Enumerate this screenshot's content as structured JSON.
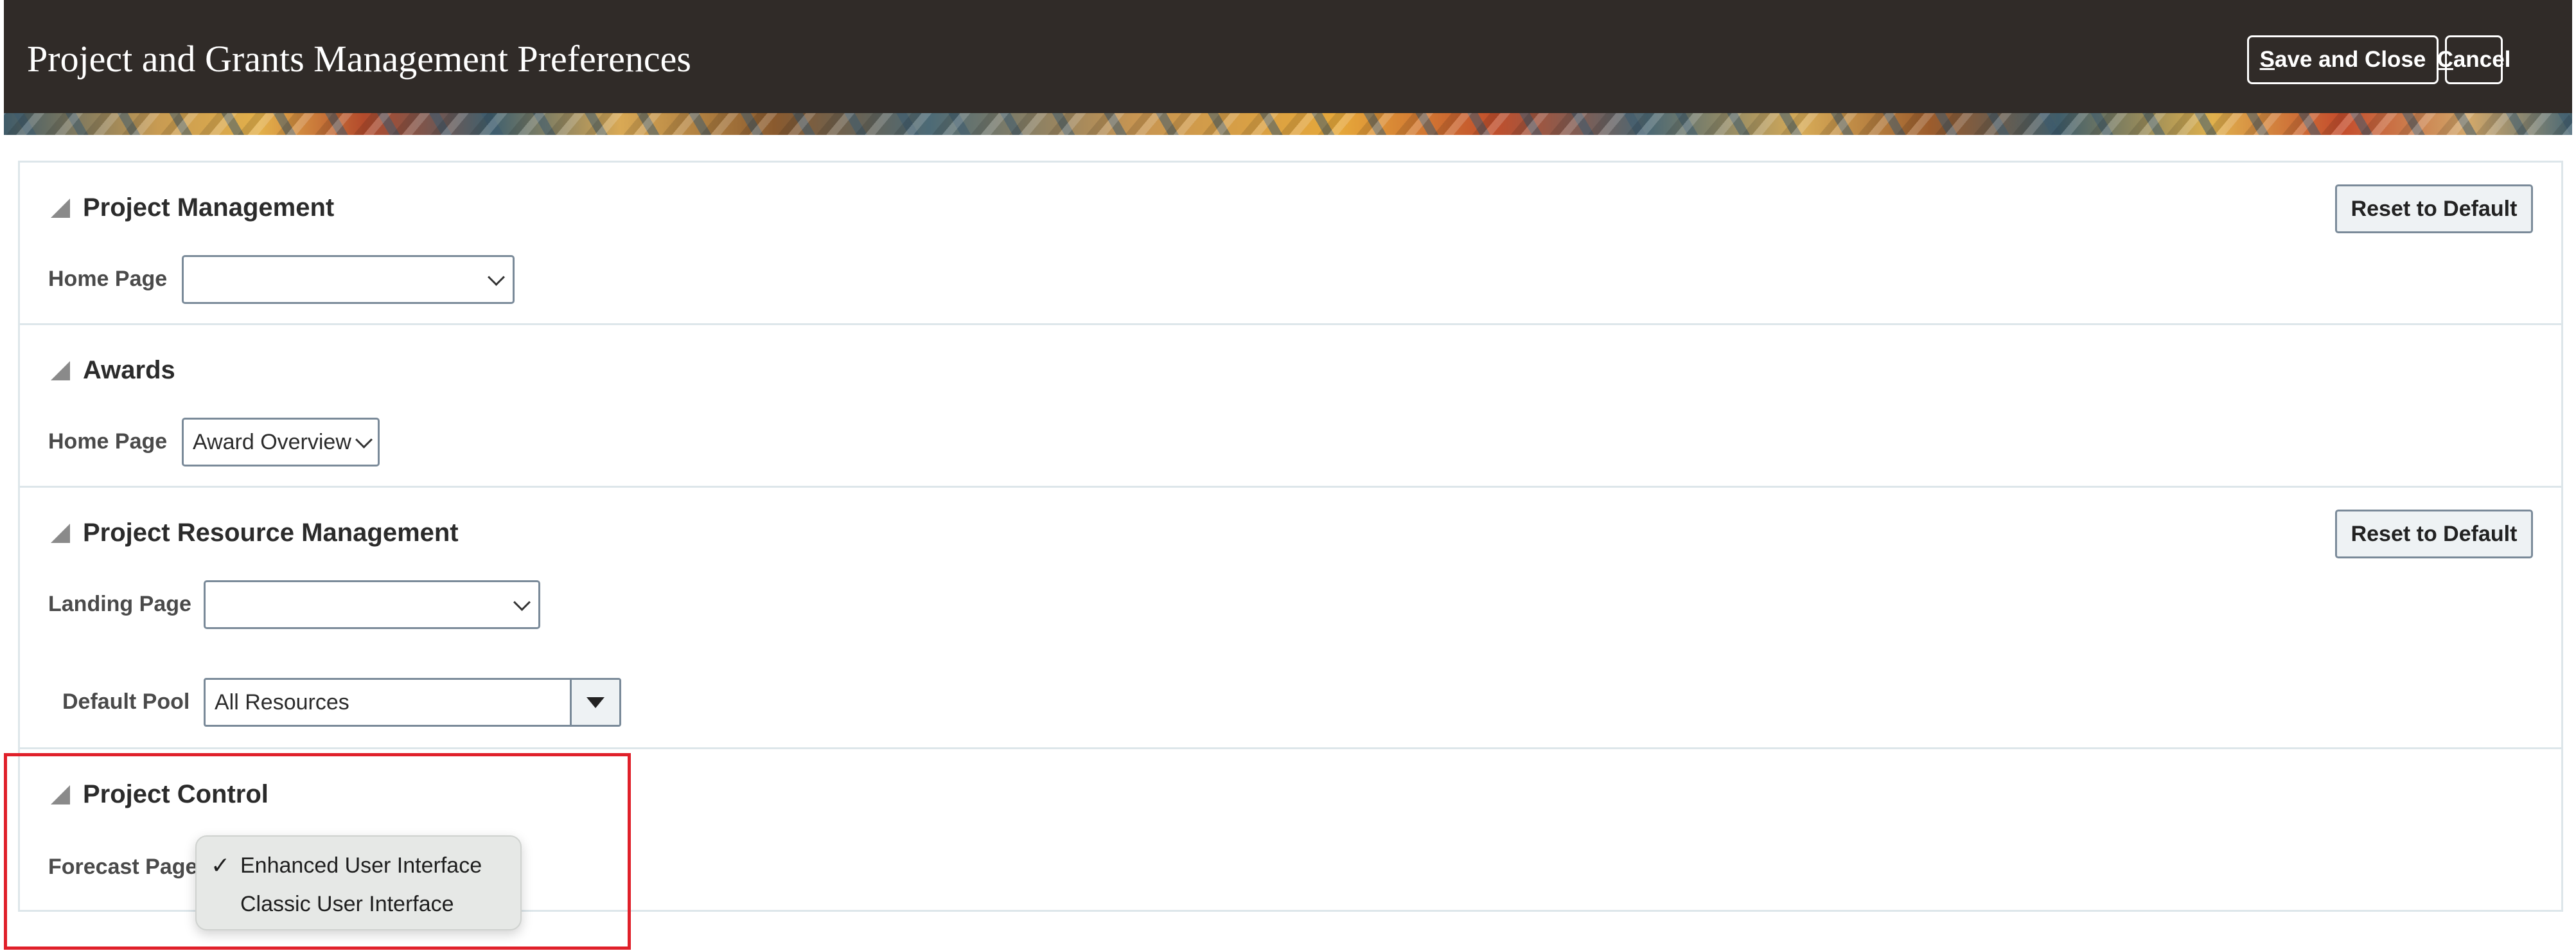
{
  "header": {
    "title": "Project and Grants Management Preferences",
    "save_close_prefix": "S",
    "save_close_rest": "ave and Close",
    "cancel_prefix": "C",
    "cancel_rest": "ancel"
  },
  "sections": {
    "project_management": {
      "title": "Project Management",
      "reset_label": "Reset to Default",
      "home_page_label": "Home Page",
      "home_page_value": ""
    },
    "awards": {
      "title": "Awards",
      "home_page_label": "Home Page",
      "home_page_value": "Award Overview"
    },
    "project_resource_management": {
      "title": "Project Resource Management",
      "reset_label": "Reset to Default",
      "landing_page_label": "Landing Page",
      "landing_page_value": "",
      "default_pool_label": "Default Pool",
      "default_pool_value": "All Resources"
    },
    "project_control": {
      "title": "Project Control",
      "forecast_page_label": "Forecast Page",
      "forecast_options": [
        {
          "label": "Enhanced User Interface",
          "selected": true
        },
        {
          "label": "Classic User Interface",
          "selected": false
        }
      ],
      "check_glyph": "✓"
    }
  },
  "colors": {
    "header_bg": "#302b28",
    "highlight_border": "#e0202a",
    "section_border": "#dde6ea"
  }
}
